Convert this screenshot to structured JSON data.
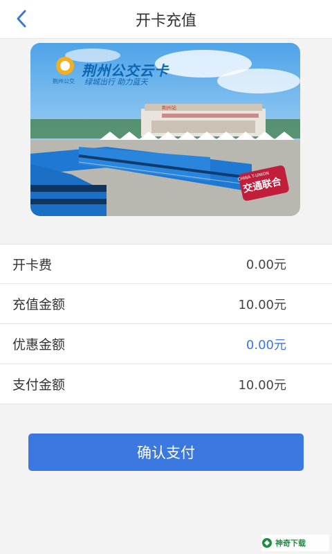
{
  "header": {
    "title": "开卡充值"
  },
  "card": {
    "title": "荆州公交云卡",
    "brand_small": "荆州公交",
    "slogan": "绿城出行 助力蓝天",
    "building_sign": "荆州站",
    "badge_main": "交通联合",
    "badge_sub": "CHINA T-UNION"
  },
  "rows": [
    {
      "label": "开卡费",
      "value": "0.00元"
    },
    {
      "label": "充值金额",
      "value": "10.00元"
    },
    {
      "label": "优惠金额",
      "value": "0.00元"
    },
    {
      "label": "支付金额",
      "value": "10.00元"
    }
  ],
  "pay_button": {
    "label": "确认支付"
  },
  "watermark": {
    "text": "神奇下载"
  },
  "colors": {
    "accent": "#3b78e0",
    "discount": "#3a78d8",
    "card_blue": "#0a66b0"
  }
}
